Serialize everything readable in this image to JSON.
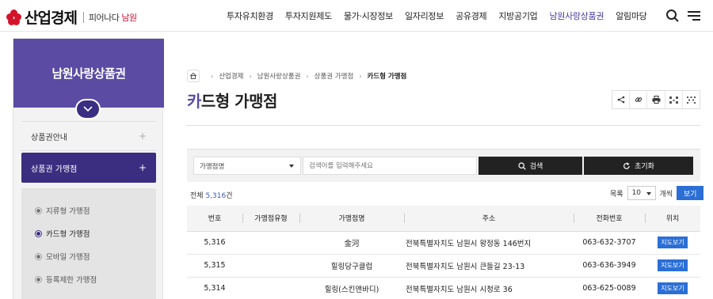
{
  "header": {
    "logo_text": "산업경제",
    "slogan_prefix": "피어나다",
    "slogan_city": "남원",
    "nav": [
      "투자유치환경",
      "투자지원제도",
      "물가·시장정보",
      "일자리정보",
      "공유경제",
      "지방공기업",
      "남원사랑상품권",
      "알림마당"
    ],
    "active_nav_index": 6,
    "icons": [
      "search-icon",
      "menu-icon"
    ]
  },
  "sidebar": {
    "title": "남원사랑상품권",
    "menus": [
      {
        "label": "상품권안내",
        "toggle": "+"
      },
      {
        "label": "상품권 가맹점",
        "toggle": "+",
        "active": true
      }
    ],
    "submenu": [
      {
        "label": "지류형 가맹점"
      },
      {
        "label": "카드형 가맹점",
        "active": true
      },
      {
        "label": "모바일 가맹점"
      },
      {
        "label": "등록제한 가맹점"
      }
    ]
  },
  "breadcrumb": [
    "산업경제",
    "남원사랑상품권",
    "상품권 가맹점",
    "카드형 가맹점"
  ],
  "page": {
    "title_accent": "카",
    "title_rest": "드형 가맹점",
    "share_icons": [
      "share-icon",
      "link-icon",
      "print-icon",
      "qr-icon",
      "scan-icon"
    ]
  },
  "search": {
    "select_value": "가맹점명",
    "placeholder": "검색어를 입력해주세요",
    "search_label": "검색",
    "reset_label": "초기화"
  },
  "list": {
    "total_label": "전체",
    "total_count": "5,316",
    "total_unit": "건",
    "rows_label": "목록",
    "rows_value": "10",
    "rows_unit": "개씩",
    "view_label": "보기"
  },
  "table": {
    "columns": [
      "번호",
      "가맹점유형",
      "가맹점명",
      "주소",
      "전화번호",
      "위치"
    ],
    "rows": [
      {
        "no": "5,316",
        "type": "",
        "name": "金河",
        "address": "전북특별자치도 남원시 왕정동 146번지",
        "phone": "063-632-3707",
        "map": "지도보기"
      },
      {
        "no": "5,315",
        "type": "",
        "name": "힐링당구클럽",
        "address": "전북특별자치도 남원시 큰들길 23-13",
        "phone": "063-636-3949",
        "map": "지도보기"
      },
      {
        "no": "5,314",
        "type": "",
        "name": "힐링(스킨앤바디)",
        "address": "전북특별자치도 남원시 시청로 36",
        "phone": "063-625-0089",
        "map": "지도보기"
      }
    ]
  },
  "colors": {
    "brand_red": "#d3142a",
    "sidebar_purple": "#5b4ba3",
    "active_menu": "#3b2e80",
    "link_blue": "#2b6fd6"
  }
}
